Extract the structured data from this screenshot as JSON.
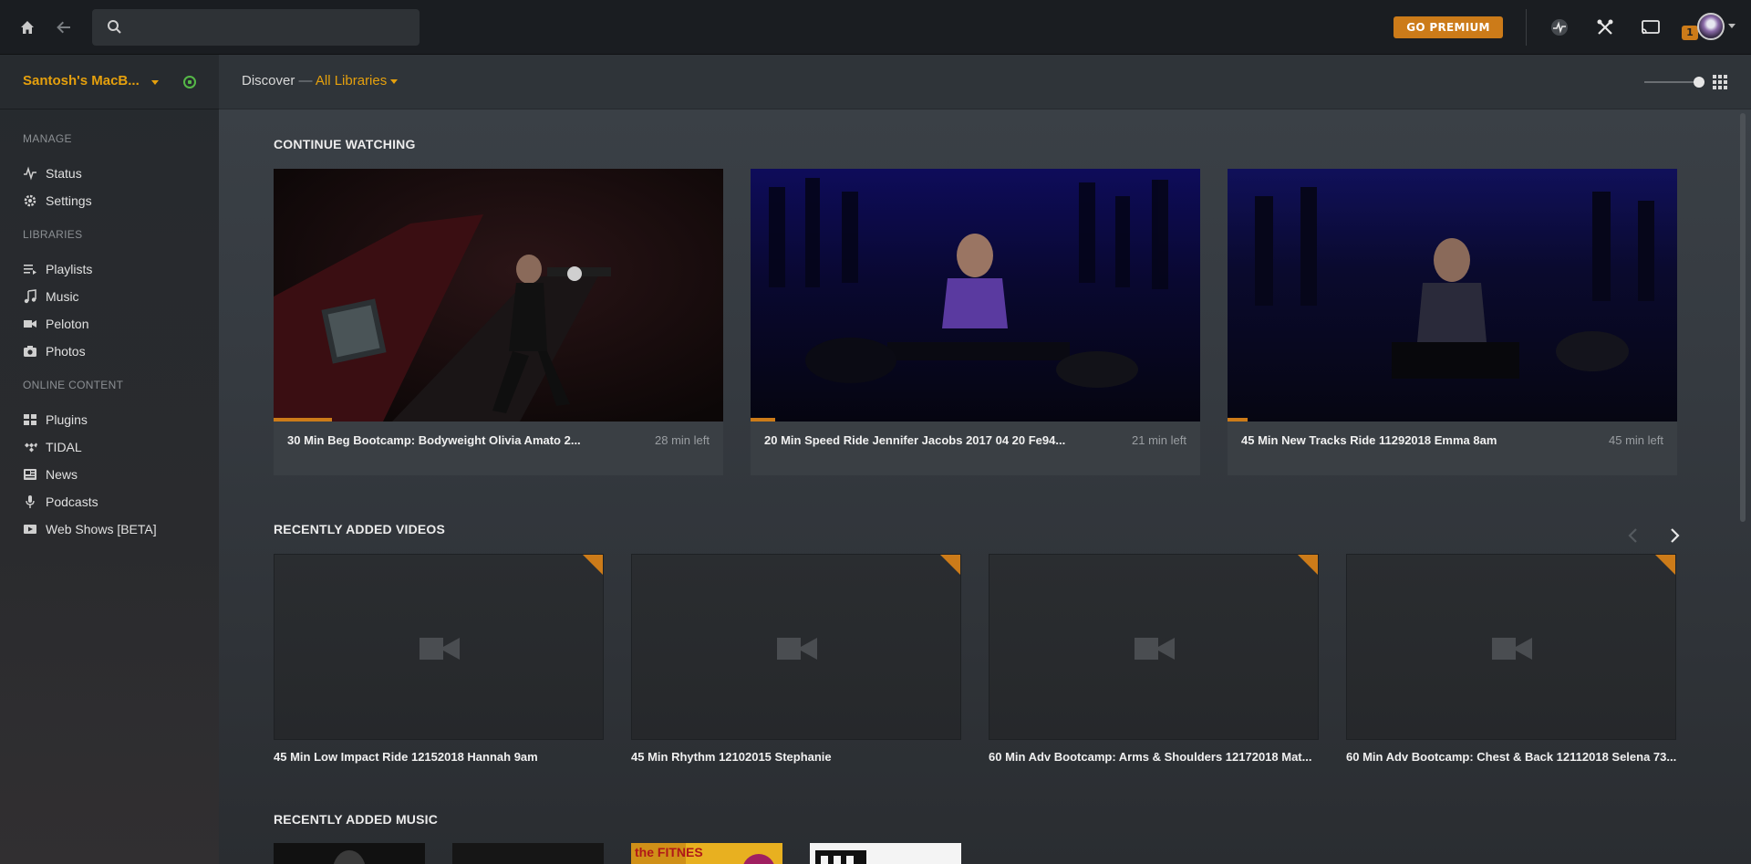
{
  "topbar": {
    "search_placeholder": "",
    "premium_label": "GO PREMIUM",
    "notification_count": "1"
  },
  "sidebar": {
    "server_name": "Santosh's MacB...",
    "sections": {
      "manage": "MANAGE",
      "libraries": "LIBRARIES",
      "online": "ONLINE CONTENT"
    },
    "manage_items": [
      {
        "label": "Status",
        "icon": "activity-icon"
      },
      {
        "label": "Settings",
        "icon": "gear-icon"
      }
    ],
    "library_items": [
      {
        "label": "Playlists",
        "icon": "playlist-icon"
      },
      {
        "label": "Music",
        "icon": "music-note-icon"
      },
      {
        "label": "Peloton",
        "icon": "video-camera-icon"
      },
      {
        "label": "Photos",
        "icon": "camera-icon"
      }
    ],
    "online_items": [
      {
        "label": "Plugins",
        "icon": "plugins-grid-icon"
      },
      {
        "label": "TIDAL",
        "icon": "tidal-icon"
      },
      {
        "label": "News",
        "icon": "news-icon"
      },
      {
        "label": "Podcasts",
        "icon": "microphone-icon"
      },
      {
        "label": "Web Shows [BETA]",
        "icon": "web-shows-icon"
      }
    ]
  },
  "header": {
    "discover": "Discover",
    "dash": "—",
    "library": "All Libraries"
  },
  "continue_watching": {
    "title": "CONTINUE WATCHING",
    "items": [
      {
        "title": "30 Min Beg Bootcamp: Bodyweight Olivia Amato 2...",
        "time_left": "28 min left",
        "progress": 0.13
      },
      {
        "title": "20 Min Speed Ride Jennifer Jacobs 2017 04 20 Fe94...",
        "time_left": "21 min left",
        "progress": 0.055
      },
      {
        "title": "45 Min New Tracks Ride 11292018 Emma 8am",
        "time_left": "45 min left",
        "progress": 0.045
      }
    ]
  },
  "recently_added_videos": {
    "title": "RECENTLY ADDED VIDEOS",
    "items": [
      {
        "title": "45 Min Low Impact Ride 12152018 Hannah 9am"
      },
      {
        "title": "45 Min Rhythm 12102015 Stephanie"
      },
      {
        "title": "60 Min Adv Bootcamp: Arms & Shoulders 12172018 Mat..."
      },
      {
        "title": "60 Min Adv Bootcamp: Chest & Back 12112018 Selena 73..."
      }
    ]
  },
  "recently_added_music": {
    "title": "RECENTLY ADDED MUSIC",
    "album_art_text": "the FITNES"
  },
  "colors": {
    "accent": "#e5a00d",
    "premium": "#cc7b19",
    "online": "#55b847"
  }
}
